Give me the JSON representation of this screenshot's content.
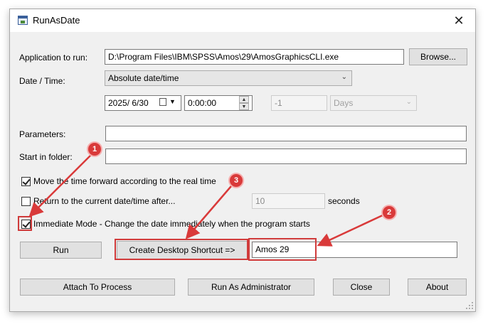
{
  "window": {
    "title": "RunAsDate",
    "close_glyph": "✕"
  },
  "app": {
    "label": "Application to run:",
    "value": "D:\\Program Files\\IBM\\SPSS\\Amos\\29\\AmosGraphicsCLI.exe",
    "browse_label": "Browse..."
  },
  "datetime": {
    "label": "Date / Time:",
    "mode": "Absolute date/time",
    "date": "2025/  6/30",
    "time": "0:00:00",
    "offset": "-1",
    "unit": "Days"
  },
  "parameters": {
    "label": "Parameters:",
    "value": ""
  },
  "start_folder": {
    "label": "Start in folder:",
    "value": ""
  },
  "options": {
    "move_forward": {
      "label": "Move the time forward according to the real time",
      "checked": true
    },
    "return_after": {
      "label": "Return to the current date/time after...",
      "checked": false,
      "value": "10",
      "unit": "seconds"
    },
    "immediate": {
      "label": "Immediate Mode - Change the date immediately when the program starts",
      "checked": true
    }
  },
  "shortcut": {
    "run_label": "Run",
    "create_label": "Create Desktop Shortcut =>",
    "name": "Amos 29"
  },
  "footer": {
    "attach_label": "Attach To Process",
    "admin_label": "Run As Administrator",
    "close_label": "Close",
    "about_label": "About"
  },
  "annotations": {
    "color": "#d93a3a",
    "badge_1": "1",
    "badge_2": "2",
    "badge_3": "3"
  }
}
